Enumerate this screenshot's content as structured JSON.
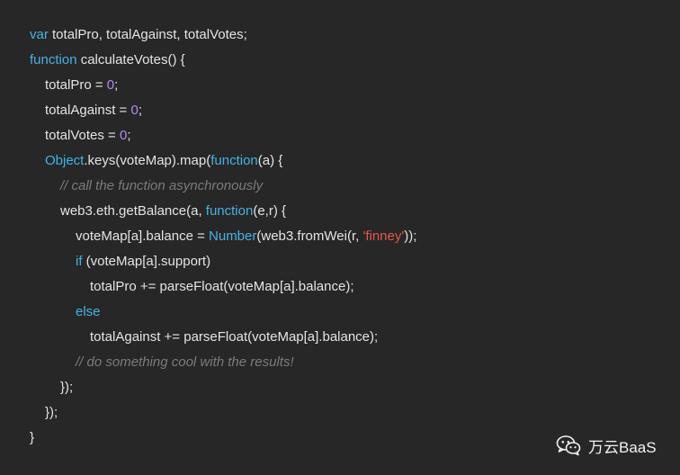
{
  "code": {
    "l1": {
      "kw": "var",
      "rest": " totalPro, totalAgainst, totalVotes;"
    },
    "l2": {
      "kw": "function",
      "rest": " calculateVotes() {"
    },
    "l3": {
      "pre": "totalPro = ",
      "num": "0",
      "post": ";"
    },
    "l4": {
      "pre": "totalAgainst = ",
      "num": "0",
      "post": ";"
    },
    "l5": {
      "pre": "totalVotes = ",
      "num": "0",
      "post": ";"
    },
    "l6": {
      "kw": "Object",
      "mid": ".keys(voteMap).map(",
      "kw2": "function",
      "post": "(a) {"
    },
    "l7": {
      "comment": "// call the function asynchronously"
    },
    "l8": {
      "pre": "web3.eth.getBalance(a, ",
      "kw": "function",
      "post": "(e,r) {"
    },
    "l9": {
      "pre": "voteMap[a].balance = ",
      "kw": "Number",
      "mid": "(web3.fromWei(r, ",
      "str": "'finney'",
      "post": "));"
    },
    "l10": {
      "kw": "if",
      "rest": " (voteMap[a].support)"
    },
    "l11": {
      "text": "totalPro += parseFloat(voteMap[a].balance);"
    },
    "l12": {
      "kw": "else"
    },
    "l13": {
      "text": "totalAgainst += parseFloat(voteMap[a].balance);"
    },
    "l14": {
      "comment": "// do something cool with the results!"
    },
    "l15": {
      "text": "});"
    },
    "l16": {
      "text": "});"
    },
    "l17": {
      "text": "}"
    }
  },
  "watermark": {
    "icon": "wechat-icon",
    "text": "万云BaaS"
  },
  "colors": {
    "background": "#272727",
    "text": "#e4e4e4",
    "keyword": "#41b4e6",
    "number": "#b788f4",
    "string": "#e5584a",
    "comment": "#7b7b7b"
  }
}
